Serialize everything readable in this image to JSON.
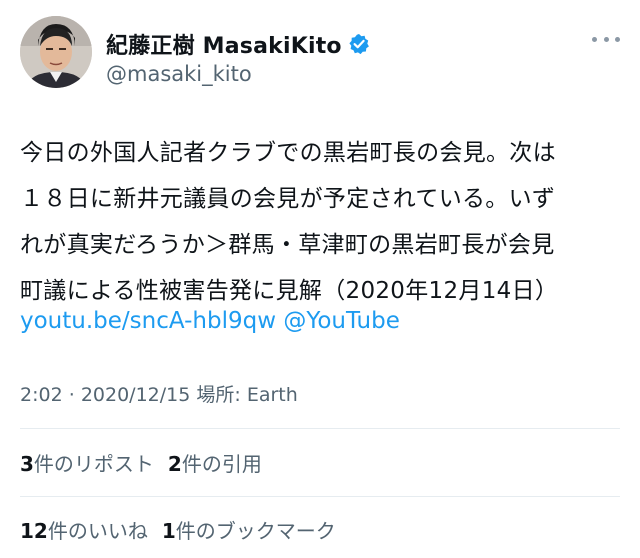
{
  "author": {
    "display_name": "紀藤正樹 MasakiKito",
    "handle": "@masaki_kito",
    "verified_icon": "verified-badge-icon",
    "avatar": "avatar-photo"
  },
  "tweet": {
    "lines": [
      "今日の外国人記者クラブでの黒岩町長の会見。次は",
      "１８日に新井元議員の会見が予定されている。いず",
      "れが真実だろうか＞群馬・草津町の黒岩町長が会見",
      "町議による性被害告発に見解（2020年12月14日）"
    ],
    "link_text": "youtu.be/sncA-hbl9qw",
    "via_text": "@YouTube"
  },
  "meta": {
    "time": "2:02",
    "separator": "·",
    "date": "2020/12/15",
    "location_label": "場所:",
    "location": "Earth"
  },
  "stats_row1": {
    "retweets_count": "3",
    "retweets_label": "件のリポスト",
    "quotes_count": "2",
    "quotes_label": "件の引用"
  },
  "stats_row2": {
    "likes_count": "12",
    "likes_label": "件のいいね",
    "bookmarks_count": "1",
    "bookmarks_label": "件のブックマーク"
  },
  "colors": {
    "link": "#1d9bf0",
    "secondary_text": "#536471",
    "primary_text": "#0f1419",
    "divider": "#e6ecf0"
  }
}
